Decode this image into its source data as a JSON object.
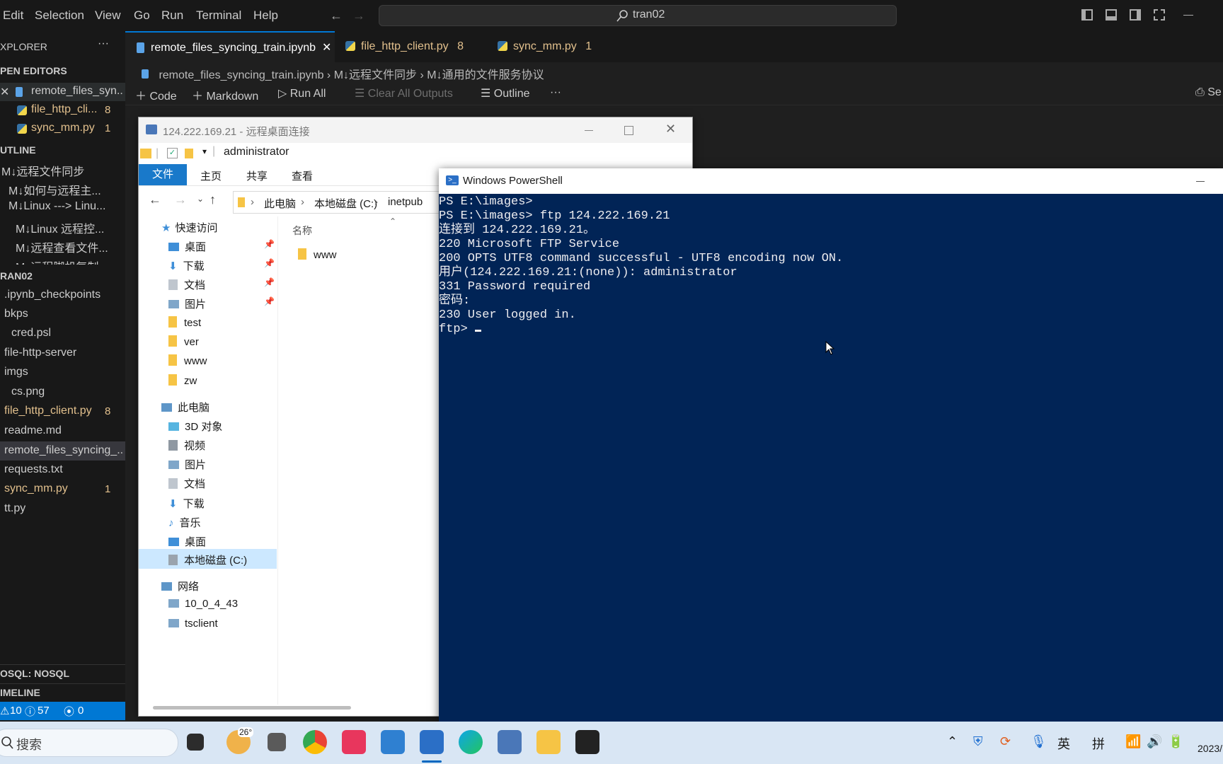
{
  "menubar": {
    "items": [
      "Edit",
      "Selection",
      "View",
      "Go",
      "Run",
      "Terminal",
      "Help"
    ],
    "search": "tran02"
  },
  "sidebar": {
    "explorer_title": "XPLORER",
    "open_editors_header": "PEN EDITORS",
    "open_editors": [
      {
        "label": "remote_files_syn...",
        "badge": ""
      },
      {
        "label": "file_http_cli...",
        "badge": "8"
      },
      {
        "label": "sync_mm.py",
        "badge": "1"
      }
    ],
    "outline_header": "UTLINE",
    "outline": [
      "M↓远程文件同步",
      "M↓如何与远程主...",
      "M↓Linux ---> Linu...",
      "M↓Linux 远程控...",
      "M↓远程查看文件...",
      "M↓远程脚机复制..."
    ],
    "folder_header": "RAN02",
    "files": [
      {
        "label": ".ipynb_checkpoints",
        "badge": ""
      },
      {
        "label": "bkps",
        "badge": ""
      },
      {
        "label": "cred.psl",
        "badge": ""
      },
      {
        "label": "file-http-server",
        "badge": ""
      },
      {
        "label": "imgs",
        "badge": ""
      },
      {
        "label": "cs.png",
        "badge": ""
      },
      {
        "label": "file_http_client.py",
        "badge": "8"
      },
      {
        "label": "readme.md",
        "badge": ""
      },
      {
        "label": "remote_files_syncing_...",
        "badge": ""
      },
      {
        "label": "requests.txt",
        "badge": ""
      },
      {
        "label": "sync_mm.py",
        "badge": "1"
      },
      {
        "label": "tt.py",
        "badge": ""
      }
    ],
    "nosql_header": "OSQL: NOSQL",
    "timeline_header": "IMELINE"
  },
  "status": {
    "warnings": "10",
    "infos": "57",
    "ports": "0"
  },
  "tabs": [
    {
      "label": "remote_files_syncing_train.ipynb",
      "badge": ""
    },
    {
      "label": "file_http_client.py",
      "badge": "8"
    },
    {
      "label": "sync_mm.py",
      "badge": "1"
    }
  ],
  "breadcrumbs": [
    "remote_files_syncing_train.ipynb",
    "M↓远程文件同步",
    "M↓通用的文件服务协议"
  ],
  "toolbar": {
    "code": "Code",
    "markdown": "Markdown",
    "run_all": "Run All",
    "clear": "Clear All Outputs",
    "outline": "Outline",
    "more": "···",
    "right": "Se"
  },
  "rdp": {
    "title": "124.222.169.21 - 远程桌面连接",
    "quick_title": "administrator",
    "ribbon": [
      "文件",
      "主页",
      "共享",
      "查看"
    ],
    "path": [
      "此电脑",
      "本地磁盘 (C:)",
      "inetpub"
    ],
    "column_header": "名称",
    "content_items": [
      "www"
    ],
    "nav_quick": "快速访问",
    "nav_quick_items": [
      "桌面",
      "下载",
      "文档",
      "图片",
      "test",
      "ver",
      "www",
      "zw"
    ],
    "nav_pc": "此电脑",
    "nav_pc_items": [
      "3D 对象",
      "视频",
      "图片",
      "文档",
      "下载",
      "音乐",
      "桌面",
      "本地磁盘 (C:)"
    ],
    "nav_network": "网络",
    "nav_network_items": [
      "10_0_4_43",
      "tsclient"
    ]
  },
  "powershell": {
    "title": "Windows PowerShell",
    "lines": [
      "PS E:\\images>",
      "PS E:\\images> ftp 124.222.169.21",
      "连接到 124.222.169.21。",
      "220 Microsoft FTP Service",
      "200 OPTS UTF8 command successful - UTF8 encoding now ON.",
      "用户(124.222.169.21:(none)): administrator",
      "331 Password required",
      "密码:",
      "230 User logged in.",
      "ftp> "
    ]
  },
  "taskbar": {
    "search_placeholder": "搜索",
    "weather": "26°",
    "ime_lang": "英",
    "ime_mode": "拼",
    "date": "2023/"
  }
}
